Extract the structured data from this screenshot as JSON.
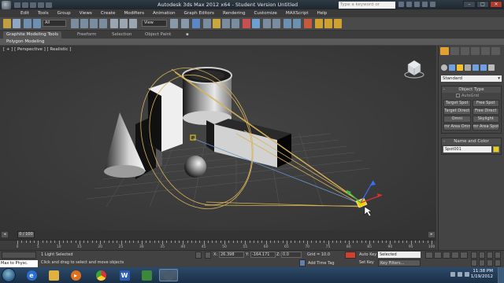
{
  "title": "Autodesk 3ds Max  2012 x64  -  Student Version   Untitled",
  "search_placeholder": "Type a keyword or phrase",
  "menu": [
    "Edit",
    "Tools",
    "Group",
    "Views",
    "Create",
    "Modifiers",
    "Animation",
    "Graph Editors",
    "Rendering",
    "Customize",
    "MAXScript",
    "Help"
  ],
  "toolbar": {
    "selection_set": "All",
    "ref_coord": "View"
  },
  "ribbon": {
    "tabs": [
      "Graphite Modeling Tools",
      "Freeform",
      "Selection",
      "Object Paint"
    ],
    "sub": "Polygon Modeling"
  },
  "viewport": {
    "label": "[ + ] [ Perspective ] [ Realistic ]"
  },
  "command_panel": {
    "category": "Standard",
    "object_type_title": "Object Type",
    "autogrid": "AutoGrid",
    "buttons": [
      "Target Spot",
      "Free Spot",
      "Target Direct",
      "Free Direct",
      "Omni",
      "Skylight",
      "mr Area Omni",
      "mr Area Spot"
    ],
    "name_color_title": "Name and Color",
    "object_name": "Spot001",
    "swatch_color": "#f0d000",
    "collapse_sign": "-"
  },
  "timeline": {
    "frame": "0 / 100",
    "ticks": [
      "0",
      "5",
      "10",
      "15",
      "20",
      "25",
      "30",
      "35",
      "40",
      "45",
      "50",
      "55",
      "60",
      "65",
      "70",
      "75",
      "80",
      "85",
      "90",
      "95",
      "100"
    ]
  },
  "status": {
    "maxscript": "Max to Physc.",
    "selected": "1 Light Selected",
    "prompt": "Click and drag to select and move objects",
    "x_label": "X:",
    "x_value": "26.398",
    "y_label": "Y:",
    "y_value": "-164.171",
    "z_label": "Z:",
    "z_value": "0.0",
    "grid": "Grid = 10.0",
    "auto_key": "Auto Key",
    "set_key": "Set Key",
    "selected_dd": "Selected",
    "key_filters": "Key Filters...",
    "add_time_tag": "Add Time Tag"
  },
  "taskbar": {
    "time": "11:38 PM",
    "date": "1/19/2012"
  },
  "colors": {
    "light": "#d8b45a",
    "accent": "#f0d000",
    "viewport_bg": "#3c3c3c"
  }
}
